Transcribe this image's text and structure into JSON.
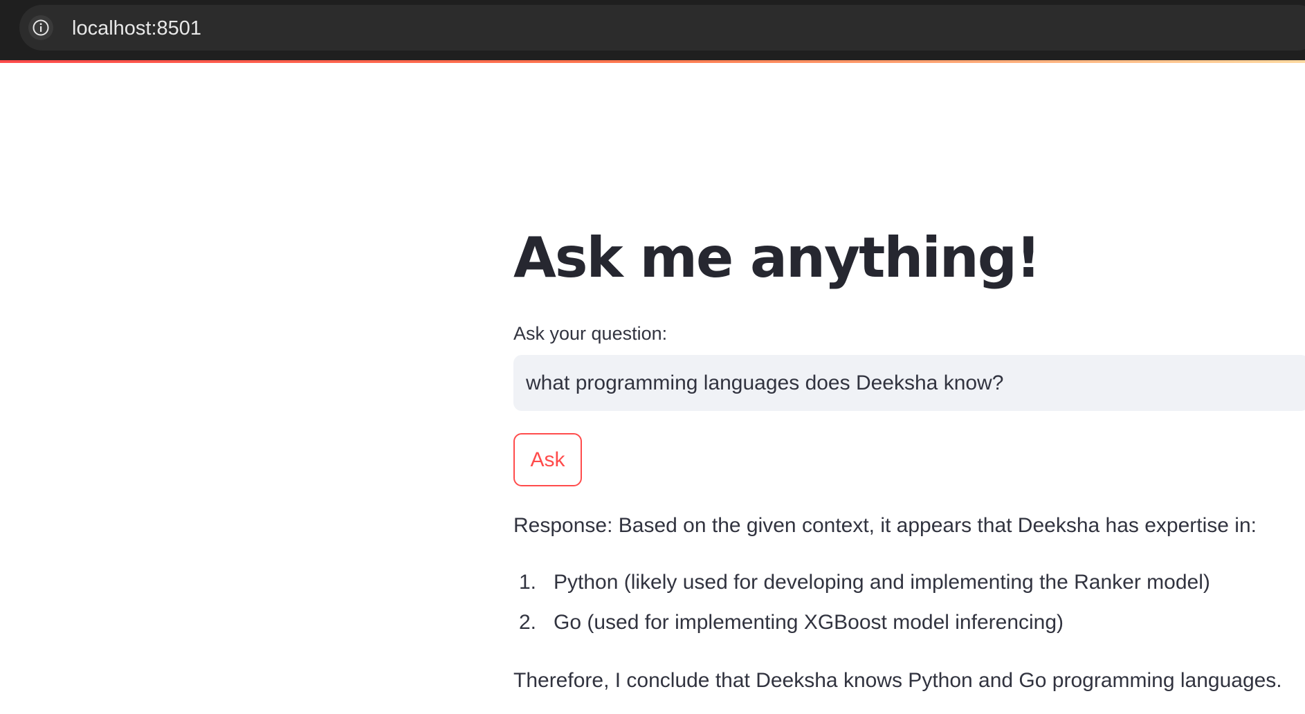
{
  "browser": {
    "url": "localhost:8501",
    "info_icon": "info-icon"
  },
  "colors": {
    "primary": "#ff4b4b",
    "text": "#31333f",
    "heading": "#262730",
    "input_bg": "#f0f2f6"
  },
  "app": {
    "title": "Ask me anything!",
    "question_label": "Ask your question:",
    "question_value": "what programming languages does Deeksha know?",
    "ask_button_label": "Ask",
    "response_intro": "Response: Based on the given context, it appears that Deeksha has expertise in:",
    "response_items": [
      {
        "number": "1.",
        "text": "Python (likely used for developing and implementing the Ranker model)"
      },
      {
        "number": "2.",
        "text": "Go (used for implementing XGBoost model inferencing)"
      }
    ],
    "conclusion": "Therefore, I conclude that Deeksha knows Python and Go programming languages."
  }
}
